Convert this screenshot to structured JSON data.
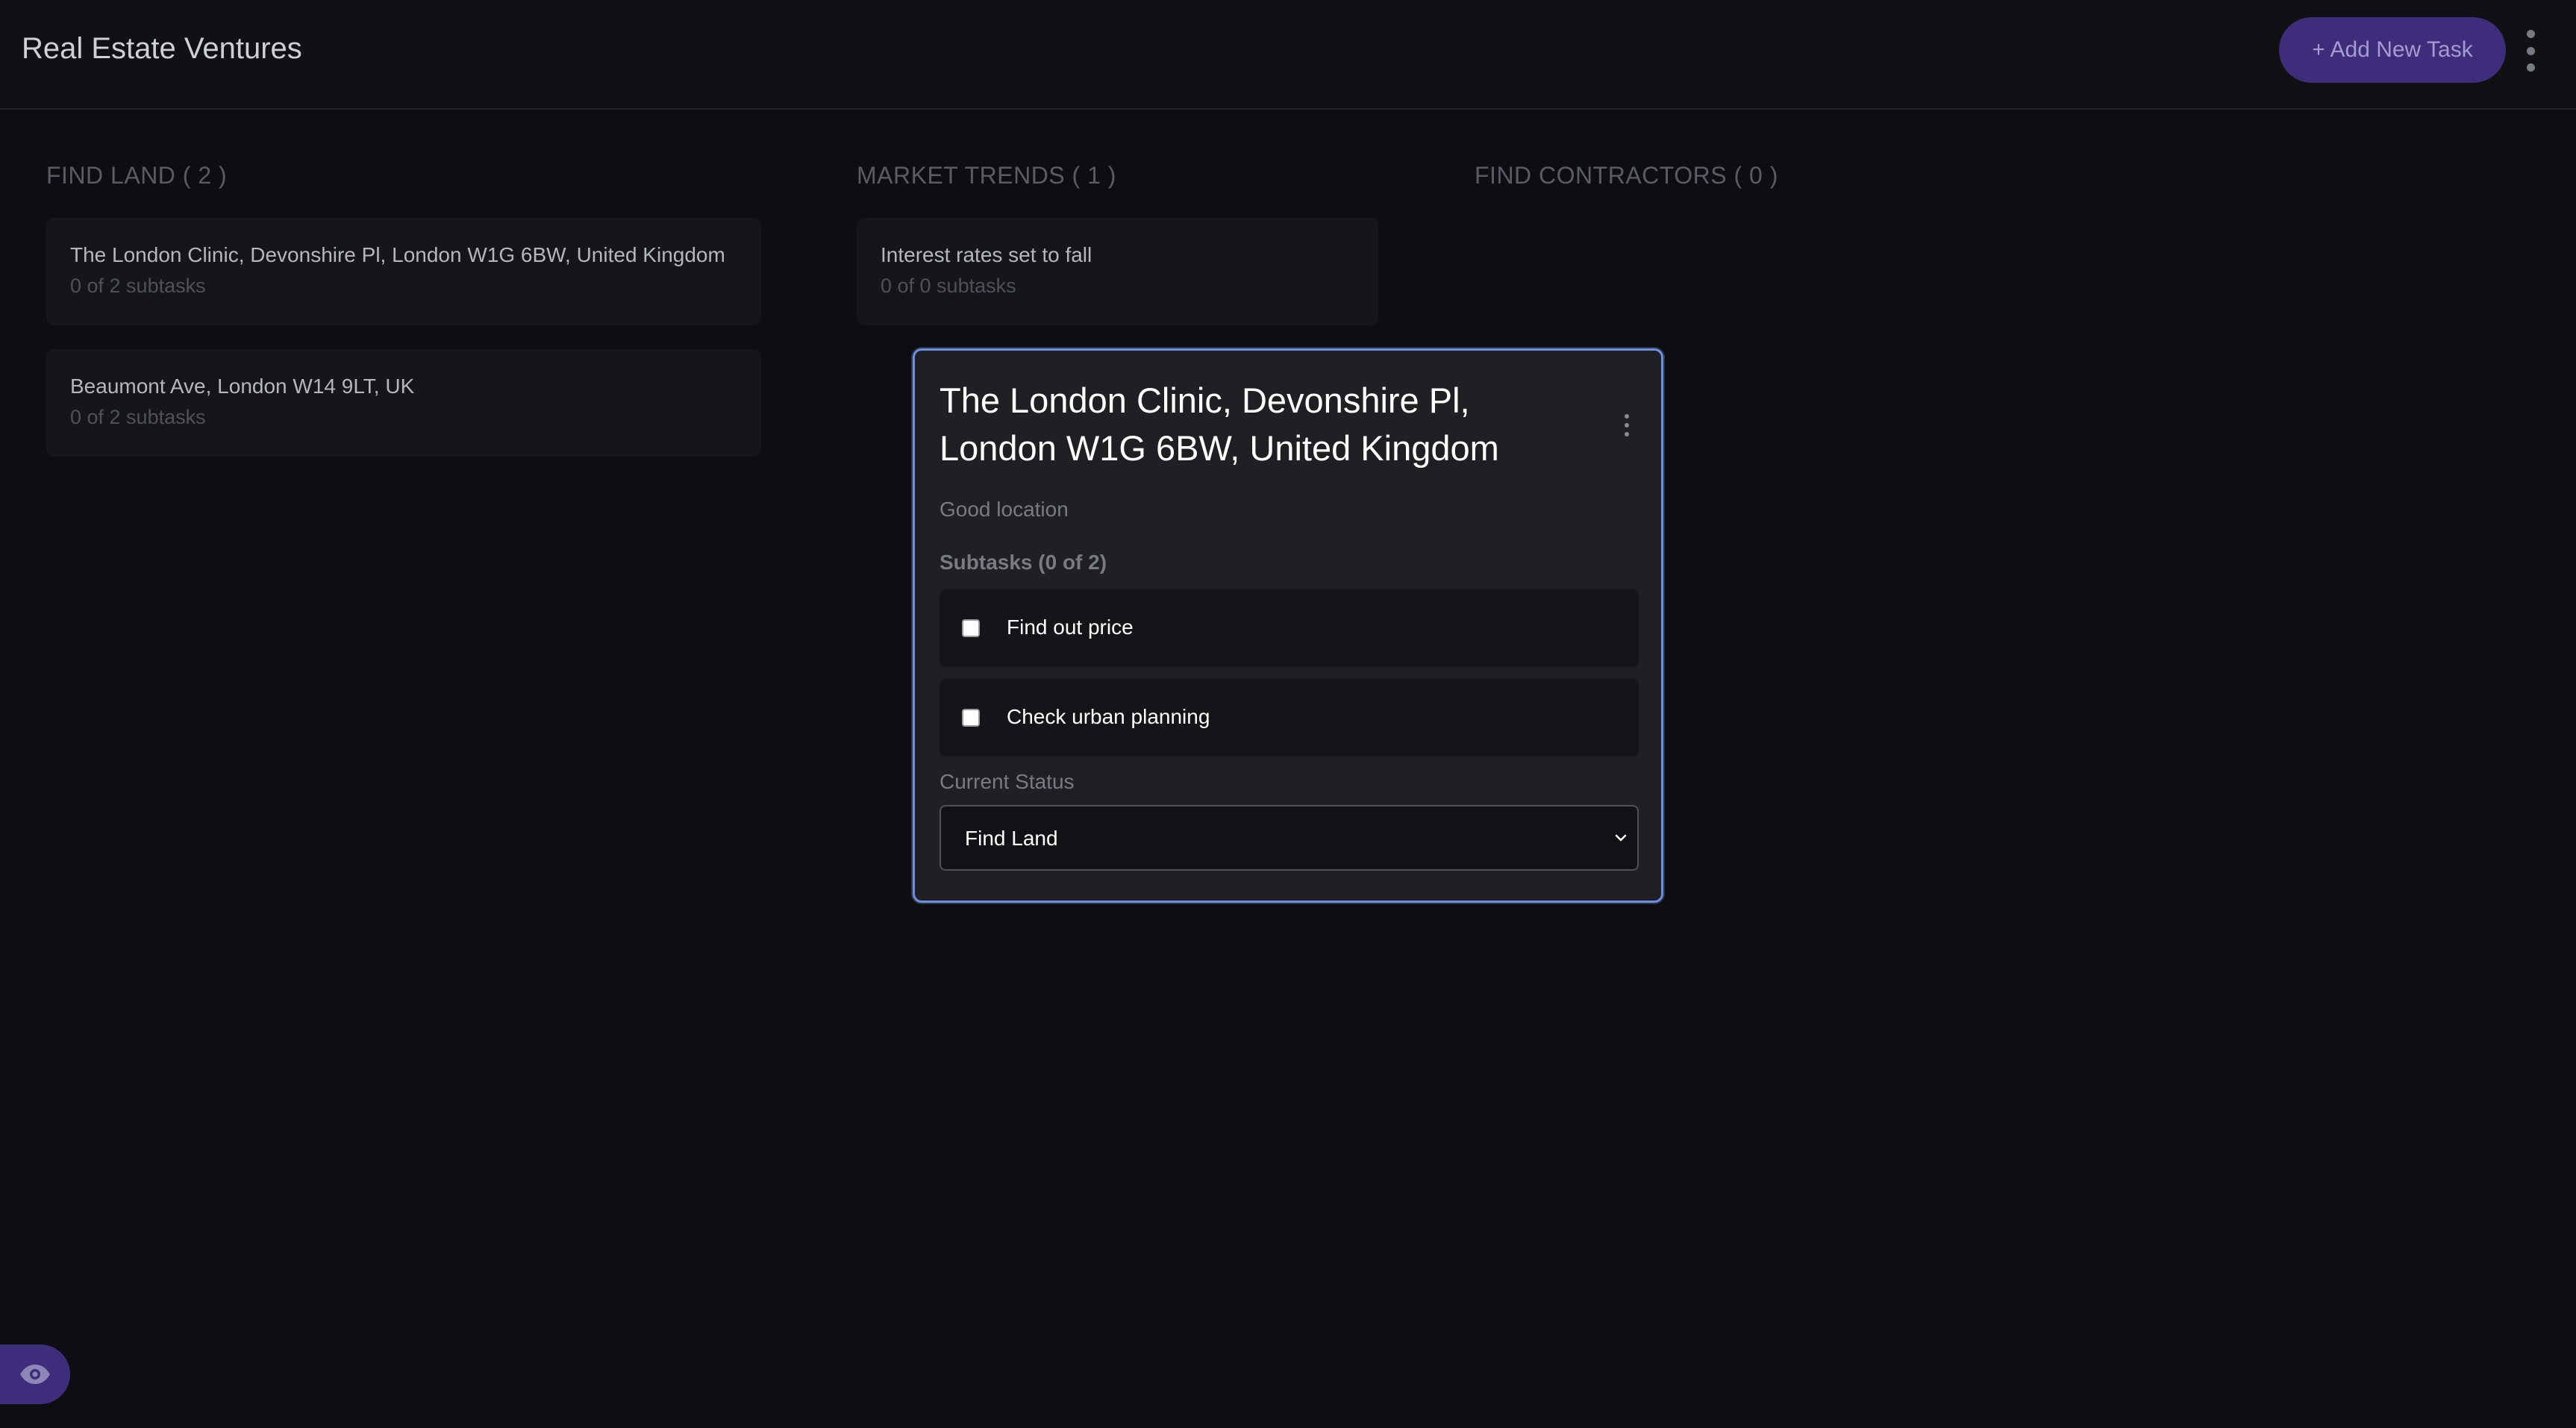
{
  "header": {
    "title": "Real Estate Ventures",
    "add_task_label": "+ Add New Task",
    "menu_icon": "vertical-ellipsis-icon"
  },
  "columns": [
    {
      "title": "FIND LAND ( 2 )",
      "cards": [
        {
          "title": "The London Clinic, Devonshire Pl, London W1G 6BW, United Kingdom",
          "subtasks": "0 of 2 subtasks"
        },
        {
          "title": "Beaumont Ave, London W14 9LT, UK",
          "subtasks": "0 of 2 subtasks"
        }
      ]
    },
    {
      "title": "MARKET TRENDS ( 1 )",
      "cards": [
        {
          "title": "Interest rates set to fall",
          "subtasks": "0 of 0 subtasks"
        }
      ]
    },
    {
      "title": "FIND CONTRACTORS ( 0 )",
      "cards": []
    }
  ],
  "modal": {
    "title": "The London Clinic, Devonshire Pl, London W1G 6BW, United Kingdom",
    "description": "Good location",
    "subtasks_heading": "Subtasks (0 of 2)",
    "subtasks": [
      {
        "label": "Find out price",
        "checked": false
      },
      {
        "label": "Check urban planning",
        "checked": false
      }
    ],
    "status_label": "Current Status",
    "status_value": "Find Land"
  },
  "colors": {
    "accent": "#3e2d7a",
    "modal_border": "#6d8fe0",
    "background": "#0e0e12"
  },
  "icons": {
    "visibility": "eye-icon"
  }
}
